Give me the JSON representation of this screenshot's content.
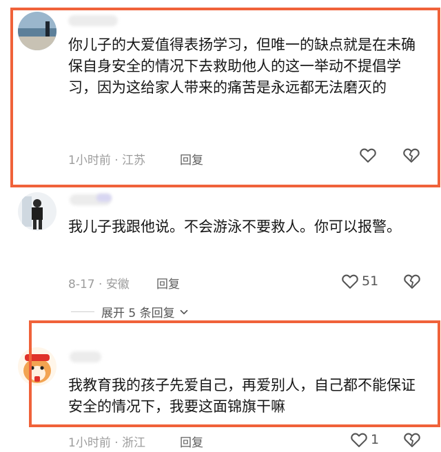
{
  "comments": [
    {
      "text": "你儿子的大爱值得表扬学习，但唯一的缺点就是在未确保自身安全的情况下去救助他人的这一举动不提倡学习，因为这给家人带来的痛苦是永远都无法磨灭的",
      "time": "1小时前",
      "location": "江苏",
      "reply_label": "回复",
      "like_count": ""
    },
    {
      "text": "我儿子我跟他说。不会游泳不要救人。你可以报警。",
      "time": "8-17",
      "location": "安徽",
      "reply_label": "回复",
      "like_count": "51"
    },
    {
      "text": "我教育我的孩子先爱自己，再爱别人，自己都不能保证安全的情况下，我要这面锦旗干嘛",
      "time": "1小时前",
      "location": "浙江",
      "reply_label": "回复",
      "like_count": "1"
    }
  ],
  "meta_separator": " · ",
  "expand_replies_label": "展开 5 条回复",
  "colors": {
    "highlight": "#f0623a",
    "meta": "#9c9c9c"
  },
  "icons": [
    "heart-icon",
    "broken-heart-icon",
    "chevron-down-icon"
  ]
}
